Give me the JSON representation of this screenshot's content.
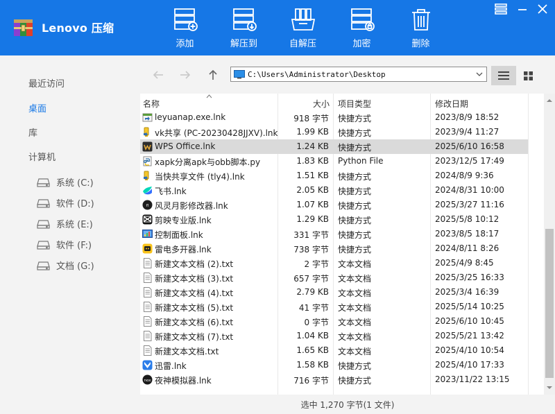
{
  "app": {
    "brand": "Lenovo 压缩"
  },
  "toolbar": [
    {
      "label": "添加",
      "icon": "add-to-archive-icon"
    },
    {
      "label": "解压到",
      "icon": "extract-to-icon"
    },
    {
      "label": "自解压",
      "icon": "self-extract-icon"
    },
    {
      "label": "加密",
      "icon": "encrypt-icon"
    },
    {
      "label": "删除",
      "icon": "delete-icon"
    }
  ],
  "sidebar": {
    "recent": "最近访问",
    "desktop": "桌面",
    "library": "库",
    "computer": "计算机",
    "drives": [
      "系统 (C:)",
      "软件 (D:)",
      "系统 (E:)",
      "软件 (F:)",
      "文档 (G:)"
    ]
  },
  "nav": {
    "path": "C:\\Users\\Administrator\\Desktop"
  },
  "columns": {
    "name": "名称",
    "size": "大小",
    "type": "项目类型",
    "date": "修改日期"
  },
  "files": [
    {
      "name": "leyuanap.exe.lnk",
      "size": "918 字节",
      "type": "快捷方式",
      "date": "2023/8/9 18:52",
      "icon": "shortcut-icon"
    },
    {
      "name": "vk共享 (PC-20230428JJXV).lnk",
      "size": "1.99 KB",
      "type": "快捷方式",
      "date": "2023/9/4 11:27",
      "icon": "share-shortcut-icon"
    },
    {
      "name": "WPS Office.lnk",
      "size": "1.24 KB",
      "type": "快捷方式",
      "date": "2025/6/10 16:58",
      "icon": "wps-icon"
    },
    {
      "name": "xapk分离apk与obb脚本.py",
      "size": "1.83 KB",
      "type": "Python File",
      "date": "2023/12/5 17:49",
      "icon": "python-file-icon"
    },
    {
      "name": "当快共享文件 (tly4).lnk",
      "size": "1.51 KB",
      "type": "快捷方式",
      "date": "2024/8/9 9:36",
      "icon": "share-shortcut-icon"
    },
    {
      "name": "飞书.lnk",
      "size": "2.05 KB",
      "type": "快捷方式",
      "date": "2024/8/31 10:00",
      "icon": "feishu-icon"
    },
    {
      "name": "风灵月影修改器.lnk",
      "size": "1.07 KB",
      "type": "快捷方式",
      "date": "2025/3/27 11:16",
      "icon": "trainer-icon"
    },
    {
      "name": "剪映专业版.lnk",
      "size": "1.29 KB",
      "type": "快捷方式",
      "date": "2025/5/8 10:12",
      "icon": "capcut-icon"
    },
    {
      "name": "控制面板.lnk",
      "size": "331 字节",
      "type": "快捷方式",
      "date": "2023/8/5 18:17",
      "icon": "control-panel-icon"
    },
    {
      "name": "雷电多开器.lnk",
      "size": "738 字节",
      "type": "快捷方式",
      "date": "2024/8/11 8:26",
      "icon": "ldplayer-icon"
    },
    {
      "name": "新建文本文档 (2).txt",
      "size": "2 字节",
      "type": "文本文档",
      "date": "2025/4/9 8:45",
      "icon": "text-file-icon"
    },
    {
      "name": "新建文本文档 (3).txt",
      "size": "657 字节",
      "type": "文本文档",
      "date": "2025/3/25 16:33",
      "icon": "text-file-icon"
    },
    {
      "name": "新建文本文档 (4).txt",
      "size": "2.79 KB",
      "type": "文本文档",
      "date": "2025/3/4 16:39",
      "icon": "text-file-icon"
    },
    {
      "name": "新建文本文档 (5).txt",
      "size": "41 字节",
      "type": "文本文档",
      "date": "2025/5/14 10:25",
      "icon": "text-file-icon"
    },
    {
      "name": "新建文本文档 (6).txt",
      "size": "0 字节",
      "type": "文本文档",
      "date": "2025/6/10 10:45",
      "icon": "text-file-icon"
    },
    {
      "name": "新建文本文档 (7).txt",
      "size": "1.04 KB",
      "type": "文本文档",
      "date": "2025/5/21 13:42",
      "icon": "text-file-icon"
    },
    {
      "name": "新建文本文档.txt",
      "size": "1.65 KB",
      "type": "文本文档",
      "date": "2025/4/10 10:54",
      "icon": "text-file-icon"
    },
    {
      "name": "迅雷.lnk",
      "size": "1.58 KB",
      "type": "快捷方式",
      "date": "2025/4/10 17:33",
      "icon": "xunlei-icon"
    },
    {
      "name": "夜神模拟器.lnk",
      "size": "716 字节",
      "type": "快捷方式",
      "date": "2023/11/22 13:15",
      "icon": "nox-icon"
    }
  ],
  "selected_file": "WPS Office.lnk",
  "status": "选中 1,270 字节(1 文件)",
  "colors": {
    "accent": "#1677e6",
    "sidebar_bg": "#f3f3f3",
    "selected_row": "#dadada"
  }
}
